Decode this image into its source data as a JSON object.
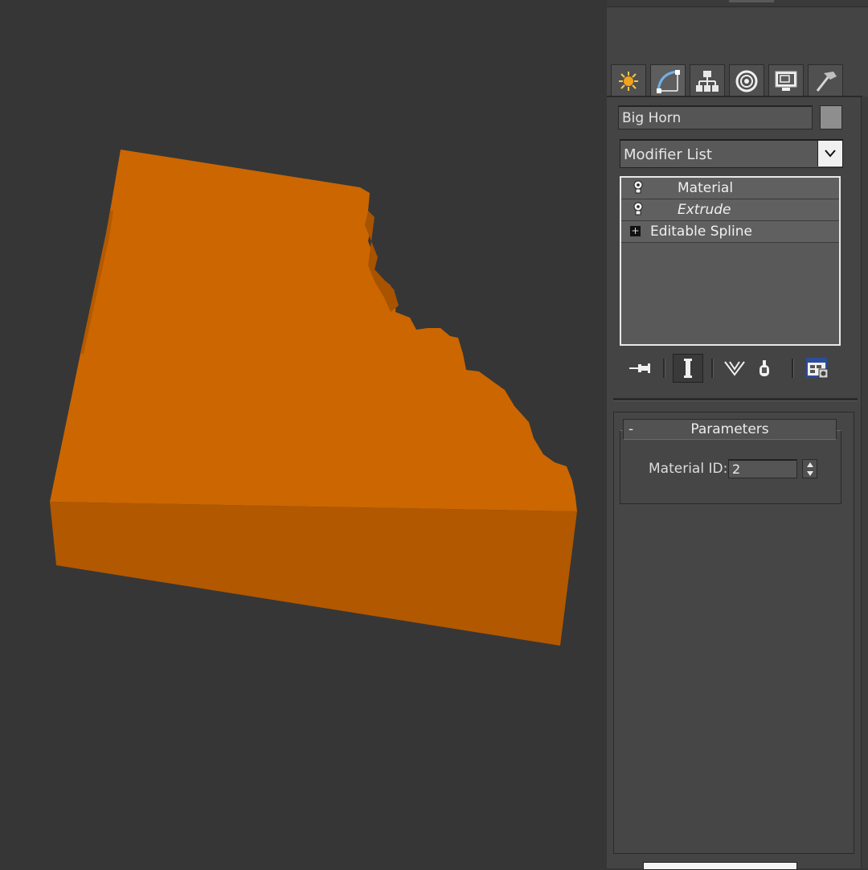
{
  "object": {
    "name": "Big Horn",
    "color": "#8e8e8e"
  },
  "modifier_list": {
    "label": "Modifier List"
  },
  "stack": {
    "items": [
      {
        "label": "Material"
      },
      {
        "label": "Extrude"
      },
      {
        "label": "Editable Spline"
      }
    ]
  },
  "tabs": [
    {
      "icon": "create-icon"
    },
    {
      "icon": "modify-icon"
    },
    {
      "icon": "hierarchy-icon"
    },
    {
      "icon": "motion-icon"
    },
    {
      "icon": "display-icon"
    },
    {
      "icon": "utilities-icon"
    }
  ],
  "parameters": {
    "title": "Parameters",
    "collapse_symbol": "-",
    "material_id_label": "Material ID:",
    "material_id_value": "2"
  },
  "colors": {
    "viewport_bg": "#363636",
    "panel_bg": "#444444",
    "object_top": "#cc6600",
    "object_side": "#b15800"
  }
}
